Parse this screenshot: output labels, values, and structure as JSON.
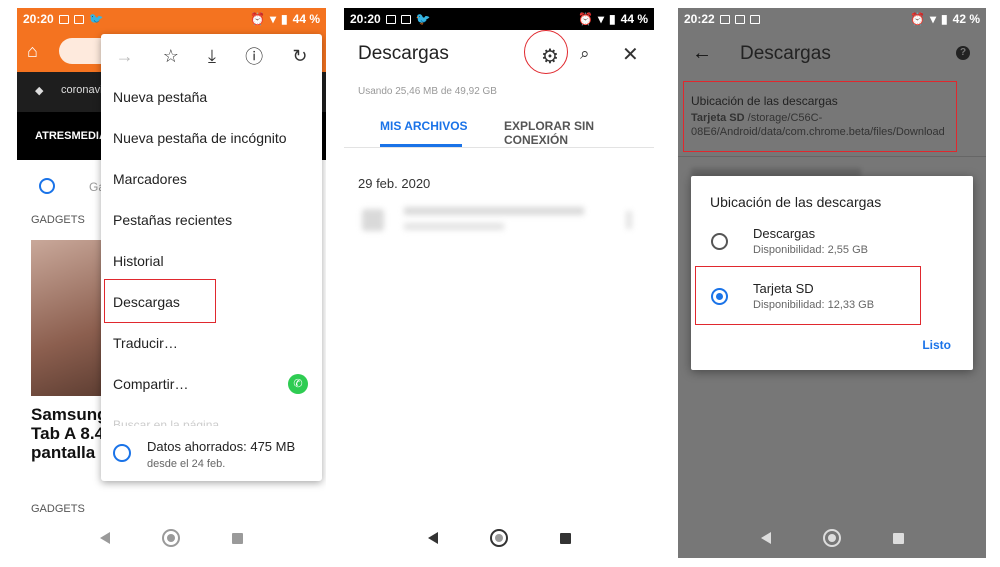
{
  "colors": {
    "accent": "#1a73e8",
    "orange": "#f47320",
    "highlight": "#e0282e",
    "whatsapp": "#2ecc52"
  },
  "phone1": {
    "status": {
      "time": "20:20",
      "battery": "44 %"
    },
    "trending": "coronavi",
    "brand": "ATRESMEDIA",
    "section_tag": "GADGETS",
    "tab_partial": "Ga",
    "headline": [
      "Samsung",
      "Tab A 8.4",
      "pantalla"
    ],
    "footer_tag": "GADGETS",
    "menu": {
      "icons": [
        "forward-icon",
        "star-icon",
        "download-icon",
        "info-icon",
        "refresh-icon"
      ],
      "items": [
        "Nueva pestaña",
        "Nueva pestaña de incógnito",
        "Marcadores",
        "Pestañas recientes",
        "Historial",
        "Descargas",
        "Traducir…",
        "Compartir…"
      ],
      "partial_item": "Buscar en la página",
      "data_saved": "Datos ahorrados: 475 MB",
      "data_since": "desde el 24 feb."
    }
  },
  "phone2": {
    "status": {
      "time": "20:20",
      "battery": "44 %"
    },
    "title": "Descargas",
    "usage": "Usando 25,46 MB de 49,92 GB",
    "tabs": [
      "MIS ARCHIVOS",
      "EXPLORAR SIN CONEXIÓN"
    ],
    "date": "29 feb. 2020"
  },
  "phone3": {
    "status": {
      "time": "20:22",
      "battery": "42 %"
    },
    "title": "Descargas",
    "location_title": "Ubicación de las descargas",
    "location_path_bold": "Tarjeta SD",
    "location_path": " /storage/C56C-08E6/Android/data/com.chrome.beta/files/Download",
    "dialog": {
      "title": "Ubicación de las descargas",
      "options": [
        {
          "label": "Descargas",
          "sub": "Disponibilidad: 2,55 GB",
          "selected": false
        },
        {
          "label": "Tarjeta SD",
          "sub": "Disponibilidad: 12,33 GB",
          "selected": true
        }
      ],
      "done": "Listo"
    }
  }
}
